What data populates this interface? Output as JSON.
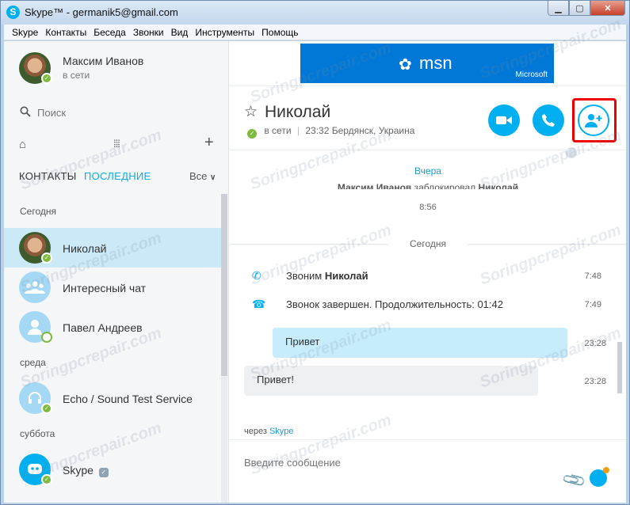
{
  "window": {
    "title": "Skype™ - germanik5@gmail.com",
    "app_icon": "S"
  },
  "menu": [
    "Skype",
    "Контакты",
    "Беседа",
    "Звонки",
    "Вид",
    "Инструменты",
    "Помощь"
  ],
  "profile": {
    "name": "Максим Иванов",
    "status": "в сети"
  },
  "search": {
    "placeholder": "Поиск"
  },
  "tabs": {
    "contacts": "КОНТАКТЫ",
    "recent": "ПОСЛЕДНИЕ",
    "filter": "Все"
  },
  "sections": {
    "today": "Сегодня",
    "wednesday": "среда",
    "saturday": "суббота"
  },
  "recent_items": [
    {
      "name": "Николай"
    },
    {
      "name": "Интересный чат"
    },
    {
      "name": "Павел Андреев"
    },
    {
      "name": "Echo / Sound Test Service"
    },
    {
      "name": "Skype"
    }
  ],
  "ad": {
    "brand": "msn",
    "sub": "Microsoft"
  },
  "conversation": {
    "contact_name": "Николай",
    "status_text": "в сети",
    "location": "23:32 Бердянск, Украина",
    "date_yesterday": "Вчера",
    "system_message_bold1": "Максим Иванов",
    "system_message_mid": " заблокировал ",
    "system_message_bold2": "Николай",
    "system_time": "8:56",
    "date_today": "Сегодня",
    "events": [
      {
        "prefix": "Звоним ",
        "bold": "Николай",
        "time": "7:48"
      },
      {
        "prefix": "Звонок завершен. Продолжительность: 01:42",
        "bold": "",
        "time": "7:49"
      }
    ],
    "messages": [
      {
        "text": "Привет",
        "time": "23:28"
      },
      {
        "text": "Привет!",
        "time": "23:28"
      }
    ],
    "via_prefix": "через ",
    "via_link": "Skype",
    "compose_placeholder": "Введите сообщение"
  },
  "watermark": "Soringpcrepair.com",
  "colors": {
    "accent": "#00aff0",
    "online": "#7dba3d",
    "selected_row": "#cbe9f7",
    "highlight": "#ee0000"
  }
}
